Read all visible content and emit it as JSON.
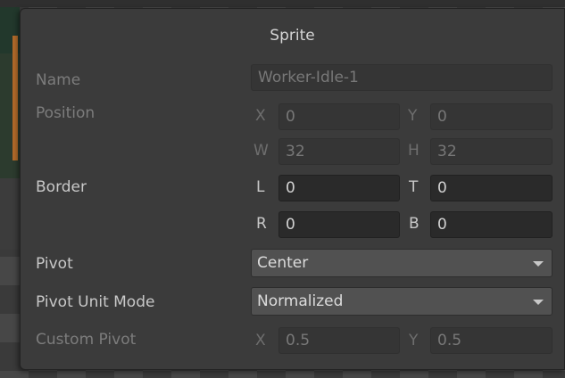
{
  "panel": {
    "title": "Sprite"
  },
  "name": {
    "label": "Name",
    "value": "Worker-Idle-1"
  },
  "position": {
    "label": "Position",
    "x_axis": "X",
    "x_value": "0",
    "y_axis": "Y",
    "y_value": "0",
    "w_axis": "W",
    "w_value": "32",
    "h_axis": "H",
    "h_value": "32"
  },
  "border": {
    "label": "Border",
    "l_axis": "L",
    "l_value": "0",
    "t_axis": "T",
    "t_value": "0",
    "r_axis": "R",
    "r_value": "0",
    "b_axis": "B",
    "b_value": "0"
  },
  "pivot": {
    "label": "Pivot",
    "selected": "Center"
  },
  "pivot_unit_mode": {
    "label": "Pivot Unit Mode",
    "selected": "Normalized"
  },
  "custom_pivot": {
    "label": "Custom Pivot",
    "x_axis": "X",
    "x_value": "0.5",
    "y_axis": "Y",
    "y_value": "0.5"
  },
  "icons": {
    "dropdown_arrow": "chevron-down-icon"
  }
}
